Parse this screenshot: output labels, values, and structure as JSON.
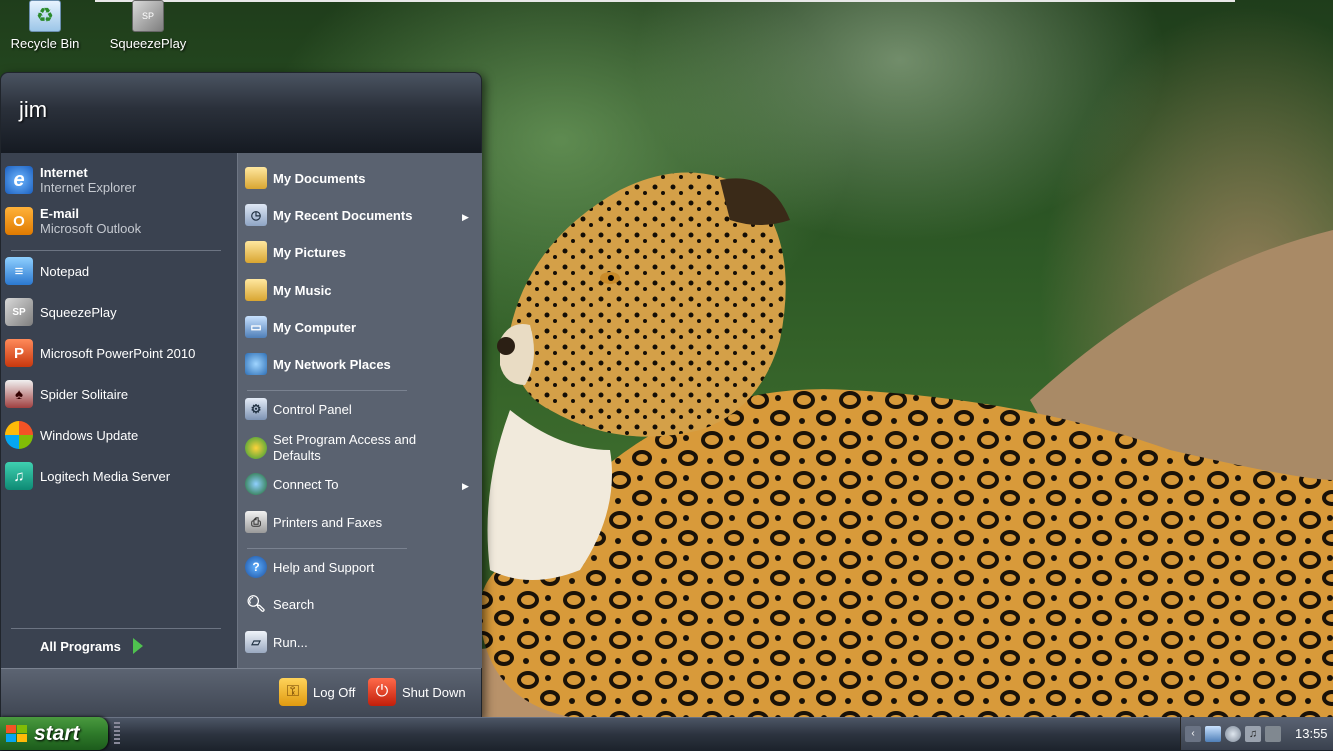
{
  "desktop": {
    "icons": [
      {
        "label": "Recycle Bin"
      },
      {
        "label": "SqueezePlay"
      }
    ]
  },
  "start_menu": {
    "username": "jim",
    "pinned": [
      {
        "title": "Internet",
        "subtitle": "Internet Explorer",
        "icon": "internet-explorer-icon"
      },
      {
        "title": "E-mail",
        "subtitle": "Microsoft Outlook",
        "icon": "outlook-icon"
      }
    ],
    "recent": [
      {
        "label": "Notepad",
        "icon": "notepad-icon"
      },
      {
        "label": "SqueezePlay",
        "icon": "squeezeplay-icon"
      },
      {
        "label": "Microsoft PowerPoint 2010",
        "icon": "powerpoint-icon"
      },
      {
        "label": "Spider Solitaire",
        "icon": "spider-solitaire-icon"
      },
      {
        "label": "Windows Update",
        "icon": "windows-update-icon"
      },
      {
        "label": "Logitech Media Server",
        "icon": "logitech-media-server-icon"
      }
    ],
    "all_programs": "All Programs",
    "places": [
      {
        "label": "My Documents",
        "icon": "folder-documents-icon"
      },
      {
        "label": "My Recent Documents",
        "icon": "recent-documents-icon"
      },
      {
        "label": "My Pictures",
        "icon": "folder-pictures-icon"
      },
      {
        "label": "My Music",
        "icon": "folder-music-icon"
      },
      {
        "label": "My Computer",
        "icon": "computer-icon"
      },
      {
        "label": "My Network Places",
        "icon": "network-places-icon"
      }
    ],
    "system": [
      {
        "label": "Control Panel",
        "icon": "control-panel-icon"
      },
      {
        "label": "Set Program Access and Defaults",
        "icon": "program-defaults-icon"
      },
      {
        "label": "Connect To",
        "icon": "connect-to-icon"
      },
      {
        "label": "Printers and Faxes",
        "icon": "printer-icon"
      }
    ],
    "help": [
      {
        "label": "Help and Support",
        "icon": "help-icon"
      },
      {
        "label": "Search",
        "icon": "search-icon"
      },
      {
        "label": "Run...",
        "icon": "run-icon"
      }
    ],
    "footer": {
      "log_off": "Log Off",
      "shut_down": "Shut Down"
    }
  },
  "taskbar": {
    "start_label": "start",
    "clock": "13:55"
  },
  "colors": {
    "menu_bg": "#3a4250",
    "menu_right_bg": "#5a6270",
    "start_green": "#2e7a2a"
  }
}
